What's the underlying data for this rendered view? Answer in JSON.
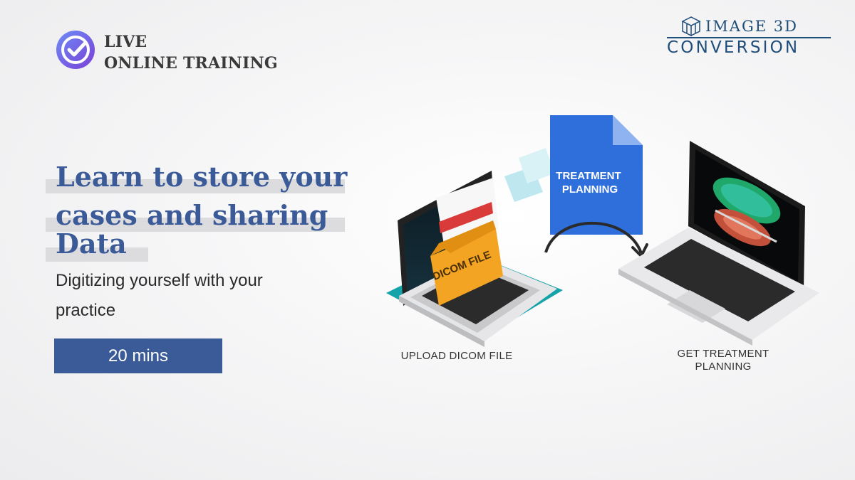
{
  "header": {
    "badge_line1": "LIVE",
    "badge_line2": "ONLINE TRAINING",
    "badge_icon": "check-circle-icon"
  },
  "brand": {
    "line1": "IMAGE 3D",
    "line2": "CONVERSION",
    "icon": "cube-icon",
    "color": "#1f4d7a"
  },
  "hero": {
    "headline_line1": "Learn to store your",
    "headline_line2": "cases and sharing",
    "headline_line3": "Data",
    "subtitle_line1": "Digitizing yourself with your",
    "subtitle_line2": "practice",
    "duration": "20 mins",
    "accent": "#3a5a98"
  },
  "illustration": {
    "folder_label": "DICOM FILE",
    "document_label_line1": "TREATMENT",
    "document_label_line2": "PLANNING",
    "caption_left": "UPLOAD DICOM FILE",
    "caption_right_line1": "GET TREATMENT",
    "caption_right_line2": "PLANNING"
  }
}
